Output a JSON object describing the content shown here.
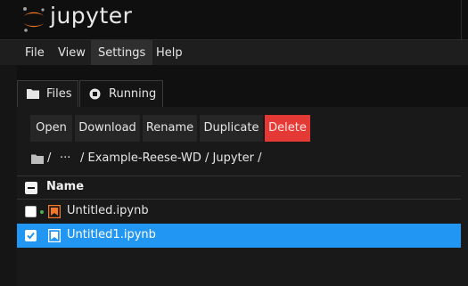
{
  "app": {
    "name": "jupyter"
  },
  "menu": [
    "File",
    "View",
    "Settings",
    "Help"
  ],
  "tabs": [
    {
      "label": "Files",
      "active": true
    },
    {
      "label": "Running",
      "active": false
    }
  ],
  "toolbar": {
    "open": "Open",
    "download": "Download",
    "rename": "Rename",
    "duplicate": "Duplicate",
    "delete": "Delete"
  },
  "breadcrumb": {
    "root": "/",
    "ellipsis": "···",
    "path": "/ Example-Reese-WD / Jupyter /"
  },
  "list": {
    "header": "Name",
    "files": [
      {
        "name": "Untitled.ipynb",
        "selected": false,
        "running": true,
        "icon": "notebook-icon-orange"
      },
      {
        "name": "Untitled1.ipynb",
        "selected": true,
        "running": false,
        "icon": "notebook-icon-blue"
      }
    ]
  },
  "colors": {
    "accent": "#2196f3",
    "danger": "#e53935",
    "brand": "#f37726"
  }
}
